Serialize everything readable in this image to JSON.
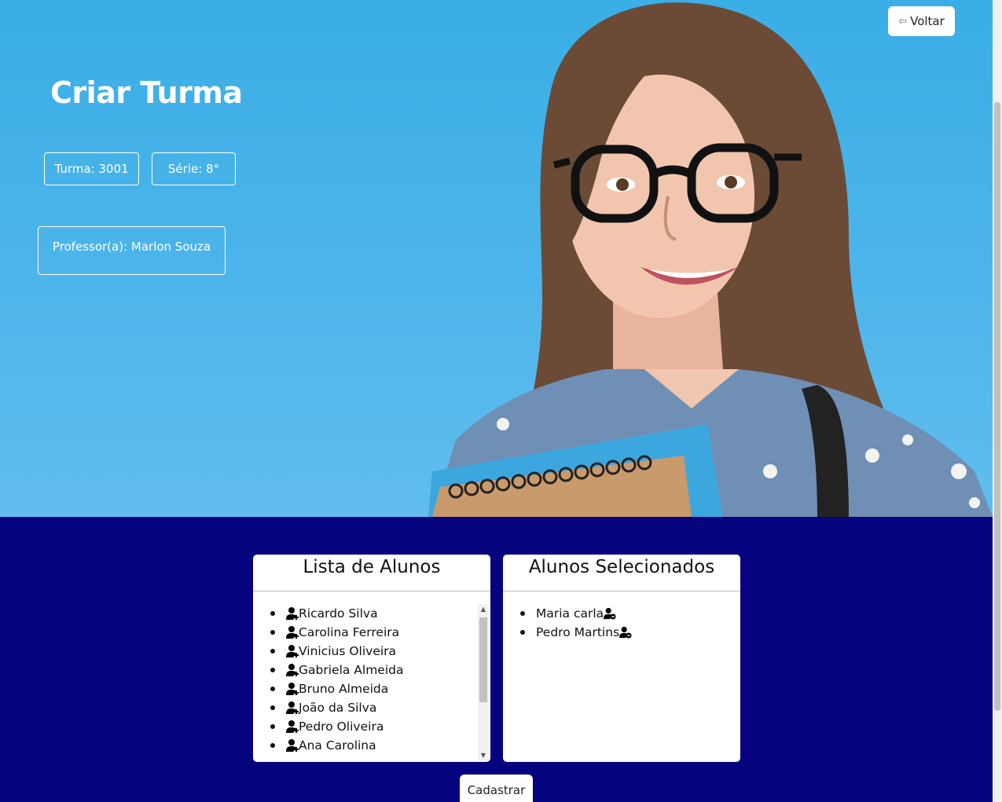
{
  "header": {
    "back_label": "Voltar",
    "back_icon": "left-arrow-icon",
    "title": "Criar Turma"
  },
  "info": {
    "turma": "Turma: 3001",
    "serie": "Série: 8°",
    "professor": "Professor(a): Marlon Souza"
  },
  "students_list": {
    "title": "Lista de Alunos",
    "add_icon": "user-plus-icon",
    "items": [
      "Ricardo Silva",
      "Carolina Ferreira",
      "Vinicius Oliveira",
      "Gabriela Almeida",
      "Bruno Almeida",
      "João da Silva",
      "Pedro Oliveira",
      "Ana Carolina"
    ]
  },
  "selected_list": {
    "title": "Alunos Selecionados",
    "remove_icon": "user-minus-icon",
    "items": [
      "Maria carla",
      "Pedro Martins"
    ]
  },
  "footer": {
    "submit_label": "Cadastrar"
  },
  "colors": {
    "background": "#06037f",
    "hero_sky": "#3aaee6"
  }
}
